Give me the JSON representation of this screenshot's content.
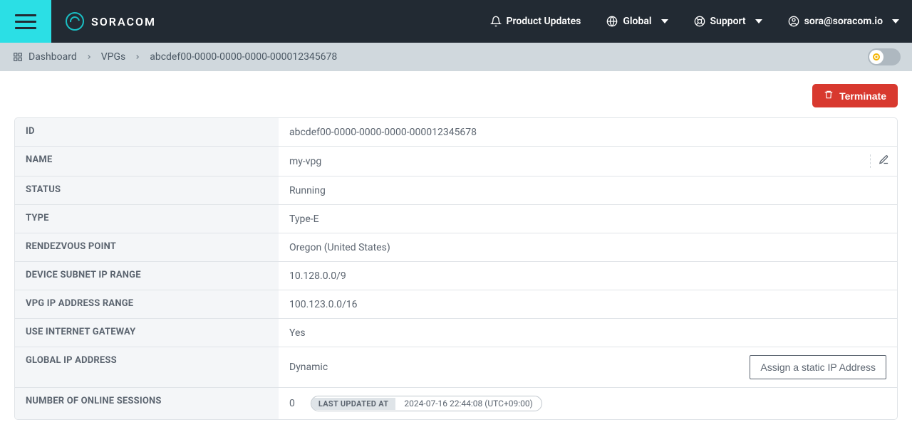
{
  "brand": {
    "name": "SORACOM"
  },
  "nav": {
    "product_updates": "Product Updates",
    "global": "Global",
    "support": "Support",
    "user": "sora@soracom.io"
  },
  "breadcrumbs": {
    "dashboard": "Dashboard",
    "vpgs": "VPGs",
    "current": "abcdef00-0000-0000-0000-000012345678"
  },
  "actions": {
    "terminate": "Terminate",
    "assign_static_ip": "Assign a static IP Address"
  },
  "labels": {
    "id": "ID",
    "name": "NAME",
    "status": "STATUS",
    "type": "TYPE",
    "rendezvous": "RENDEZVOUS POINT",
    "device_subnet": "DEVICE SUBNET IP RANGE",
    "vpg_ip_range": "VPG IP ADDRESS RANGE",
    "use_igw": "USE INTERNET GATEWAY",
    "global_ip": "GLOBAL IP ADDRESS",
    "online_sessions": "NUMBER OF ONLINE SESSIONS",
    "last_updated_at": "LAST UPDATED AT"
  },
  "values": {
    "id": "abcdef00-0000-0000-0000-000012345678",
    "name": "my-vpg",
    "status": "Running",
    "type": "Type-E",
    "rendezvous": "Oregon (United States)",
    "device_subnet": "10.128.0.0/9",
    "vpg_ip_range": "100.123.0.0/16",
    "use_igw": "Yes",
    "global_ip": "Dynamic",
    "online_sessions": "0",
    "last_updated_at": "2024-07-16 22:44:08 (UTC+09:00)"
  }
}
